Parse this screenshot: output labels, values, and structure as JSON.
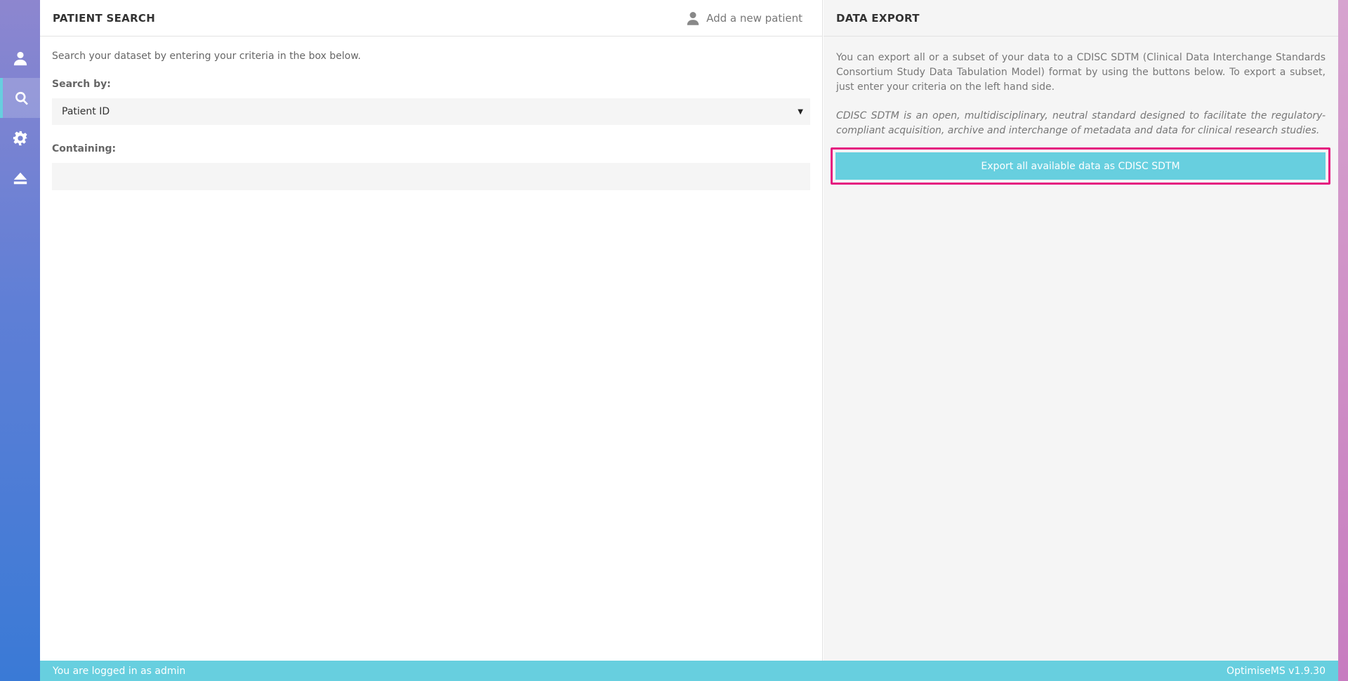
{
  "colors": {
    "accent": "#67cfdf",
    "highlight": "#e5197f",
    "sidebar_top": "#8d86cf",
    "sidebar_bottom": "#3a7ad6"
  },
  "sidebar": {
    "items": [
      {
        "icon": "user-icon",
        "active": false
      },
      {
        "icon": "search-icon",
        "active": true
      },
      {
        "icon": "gear-icon",
        "active": false
      },
      {
        "icon": "eject-icon",
        "active": false
      }
    ]
  },
  "patient_search": {
    "title": "PATIENT SEARCH",
    "add_patient_label": "Add a new patient",
    "intro": "Search your dataset by entering your criteria in the box below.",
    "search_by_label": "Search by:",
    "search_by_value": "Patient ID",
    "containing_label": "Containing:",
    "containing_value": ""
  },
  "data_export": {
    "title": "DATA EXPORT",
    "description": "You can export all or a subset of your data to a CDISC SDTM (Clinical Data Interchange Standards Consortium Study Data Tabulation Model) format by using the buttons below. To export a subset, just enter your criteria on the left hand side.",
    "note": "CDISC SDTM is an open, multidisciplinary, neutral standard designed to facilitate the regulatory-compliant acquisition, archive and interchange of metadata and data for clinical research studies.",
    "export_button_label": "Export all available data as CDISC SDTM"
  },
  "footer": {
    "login_status": "You are logged in as admin",
    "version": "OptimiseMS v1.9.30"
  }
}
